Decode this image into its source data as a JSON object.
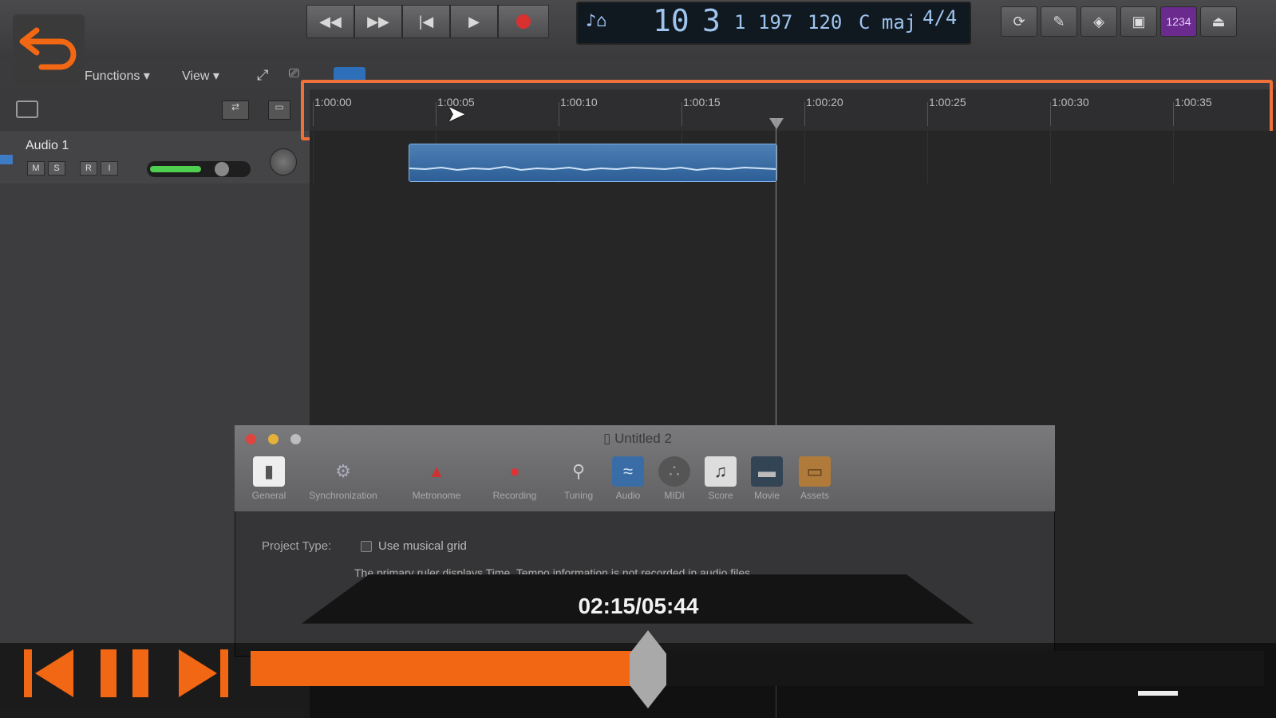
{
  "transport": {
    "rewind_icon": "rewind-icon",
    "forward_icon": "fast-forward-icon",
    "to_start_icon": "skip-to-start-icon",
    "play_icon": "play-icon",
    "record_icon": "record-icon"
  },
  "lcd": {
    "bar": "10",
    "beat": "3",
    "div": "1",
    "tick": "197",
    "tempo": "120",
    "key": "C maj",
    "signature": "4/4"
  },
  "right_toolbar": {
    "counter_badge": "1234"
  },
  "menus": {
    "functions": "Functions",
    "view": "View"
  },
  "track": {
    "name": "Audio 1",
    "buttons": [
      "M",
      "S",
      "R",
      "I"
    ],
    "volume": 0.7
  },
  "ruler": {
    "ticks": [
      "1:00:00",
      "1:00:05",
      "1:00:10",
      "1:00:15",
      "1:00:20",
      "1:00:25",
      "1:00:30",
      "1:00:35"
    ]
  },
  "dialog": {
    "title": "Untitled 2",
    "tabs": [
      "General",
      "Synchronization",
      "Metronome",
      "Recording",
      "Tuning",
      "Audio",
      "MIDI",
      "Score",
      "Movie",
      "Assets"
    ],
    "project_type_label": "Project Type:",
    "checkbox_label": "Use musical grid",
    "info_text": "The primary ruler displays Time. Tempo information is not recorded in audio files."
  },
  "player": {
    "timestamp": "02:15/05:44",
    "progress": 0.3923
  },
  "colors": {
    "accent": "#f26714",
    "highlight": "#f0703a",
    "region": "#3a6da5",
    "record": "#d93030"
  }
}
